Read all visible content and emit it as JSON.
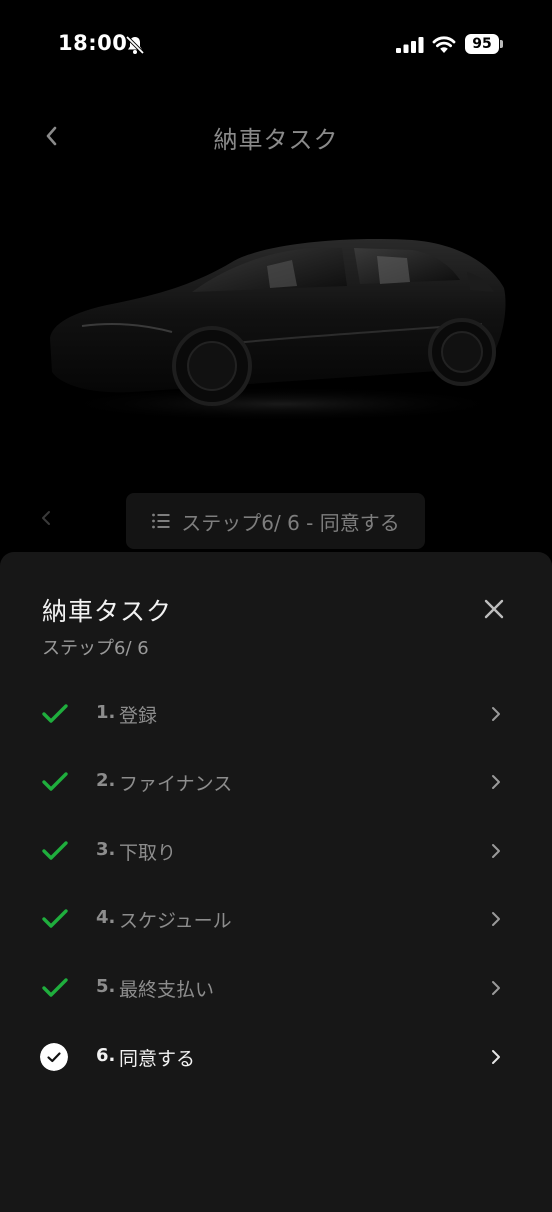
{
  "status_bar": {
    "time": "18:00",
    "battery": "95",
    "icons": [
      "bell-slash-icon",
      "signal-icon",
      "wifi-icon",
      "battery-icon"
    ]
  },
  "header": {
    "title": "納車タスク",
    "back_icon": "chevron-left-icon"
  },
  "step_bar": {
    "label": "ステップ6/ 6 - 同意する",
    "prev_icon": "chevron-left-icon",
    "list_icon": "list-icon"
  },
  "sheet": {
    "title": "納車タスク",
    "subtitle": "ステップ6/ 6",
    "close_icon": "close-icon",
    "tasks": [
      {
        "number": "1.",
        "label": "登録",
        "status": "done"
      },
      {
        "number": "2.",
        "label": "ファイナンス",
        "status": "done"
      },
      {
        "number": "3.",
        "label": "下取り",
        "status": "done"
      },
      {
        "number": "4.",
        "label": "スケジュール",
        "status": "done"
      },
      {
        "number": "5.",
        "label": "最終支払い",
        "status": "done"
      },
      {
        "number": "6.",
        "label": "同意する",
        "status": "current"
      }
    ]
  },
  "colors": {
    "background": "#000000",
    "sheet": "#171717",
    "check_green": "#1fae3d",
    "muted_text": "#8d8d8d"
  }
}
